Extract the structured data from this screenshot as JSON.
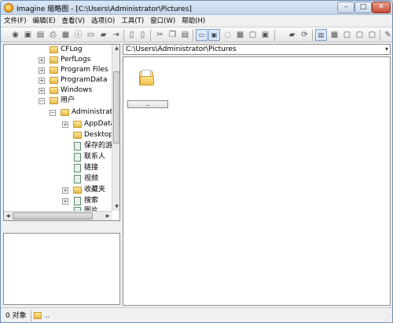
{
  "window": {
    "title": "Imagine 缩略图 - [C:\\Users\\Administrator\\Pictures]",
    "min_label": "–",
    "max_label": "□",
    "close_label": "✕"
  },
  "menu": [
    {
      "label": "文件(F)"
    },
    {
      "label": "编辑(E)"
    },
    {
      "label": "查看(V)"
    },
    {
      "label": "选项(O)"
    },
    {
      "label": "工具(T)"
    },
    {
      "label": "窗口(W)"
    },
    {
      "label": "帮助(H)"
    }
  ],
  "tree": {
    "items": [
      {
        "label": "CFLog",
        "expander": ""
      },
      {
        "label": "PerfLogs",
        "expander": "+"
      },
      {
        "label": "Program Files",
        "expander": "+"
      },
      {
        "label": "ProgramData",
        "expander": "+"
      },
      {
        "label": "Windows",
        "expander": "+"
      },
      {
        "label": "用户",
        "expander": "−"
      },
      {
        "label": "Administrator",
        "expander": "−"
      },
      {
        "label": "AppData",
        "expander": "+"
      },
      {
        "label": "Desktop",
        "expander": ""
      },
      {
        "label": "保存的游戏",
        "expander": ""
      },
      {
        "label": "联系人",
        "expander": ""
      },
      {
        "label": "链接",
        "expander": ""
      },
      {
        "label": "视频",
        "expander": ""
      },
      {
        "label": "收藏夹",
        "expander": "+"
      },
      {
        "label": "搜索",
        "expander": "+"
      },
      {
        "label": "图片",
        "expander": ""
      }
    ]
  },
  "path_bar": {
    "value": "C:\\Users\\Administrator\\Pictures",
    "dropdown_icon": "▾"
  },
  "thumbnails": [
    {
      "caption": "..",
      "icon": "folder-icon"
    }
  ],
  "status": {
    "count": "0 对象",
    "path": ".."
  }
}
